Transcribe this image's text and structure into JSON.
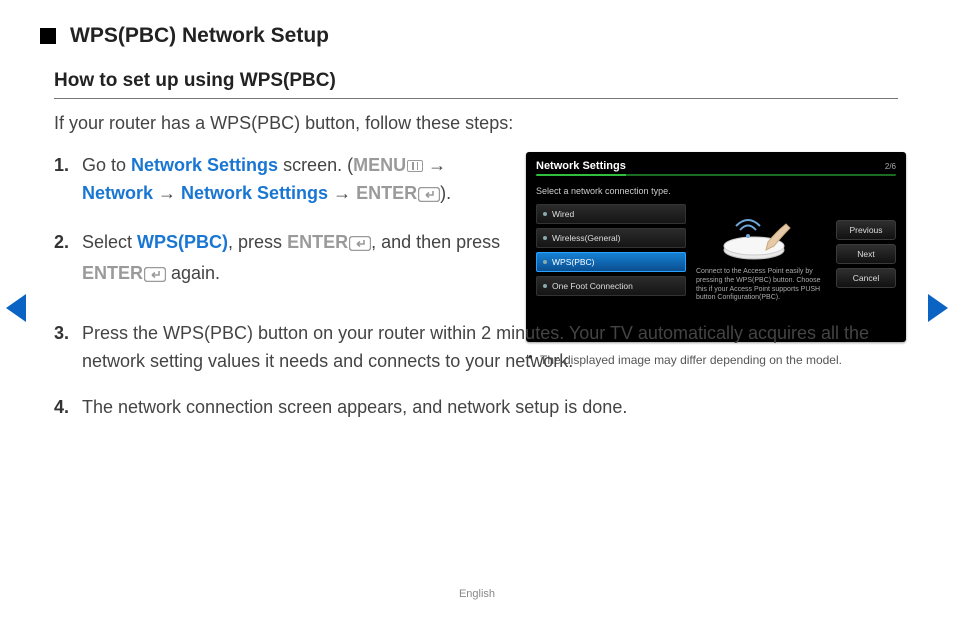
{
  "heading": "WPS(PBC) Network Setup",
  "subheading": "How to set up using WPS(PBC)",
  "intro": "If your router has a WPS(PBC) button, follow these steps:",
  "steps": {
    "s1": {
      "a": "Go to ",
      "network_settings": "Network Settings",
      "b": " screen. (",
      "menu": "MENU",
      "arrow": " → ",
      "network": "Network",
      "enter": "ENTER",
      "c": ")."
    },
    "s2": {
      "a": "Select ",
      "wpspbc": "WPS(PBC)",
      "b": ", press ",
      "enter": "ENTER",
      "c": ", and then press ",
      "d": " again."
    },
    "s3": "Press the WPS(PBC) button on your router within 2 minutes. Your TV automatically acquires all the network setting values it needs and connects to your network.",
    "s4": "The network connection screen appears, and network setup is done."
  },
  "tv": {
    "title": "Network Settings",
    "page": "2/6",
    "subtitle": "Select a network connection type.",
    "options": [
      "Wired",
      "Wireless(General)",
      "WPS(PBC)",
      "One Foot Connection"
    ],
    "desc": "Connect to the Access Point easily by pressing the WPS(PBC) button. Choose this if your Access Point supports PUSH button Configuration(PBC).",
    "buttons": {
      "prev": "Previous",
      "next": "Next",
      "cancel": "Cancel"
    }
  },
  "caption": "The displayed image may differ depending on the model.",
  "footer": "English"
}
